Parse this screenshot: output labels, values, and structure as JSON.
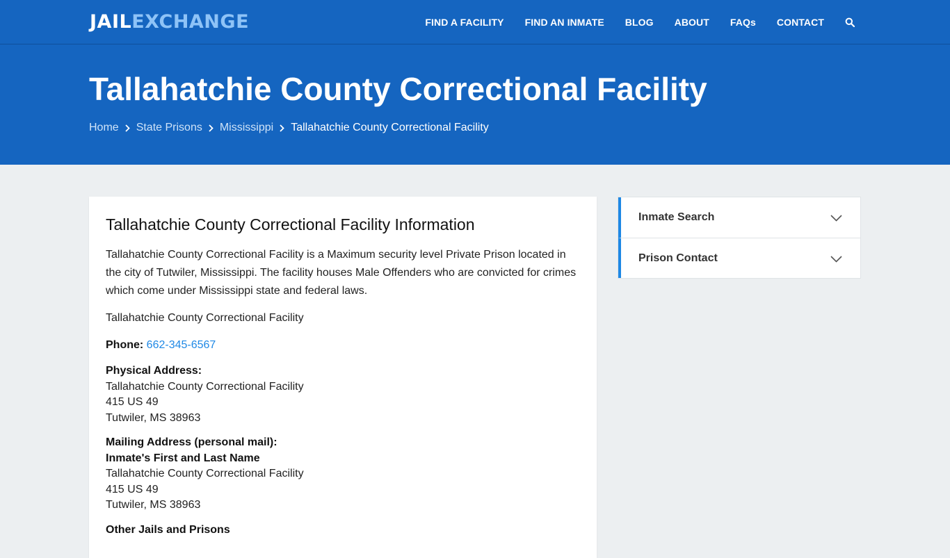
{
  "header": {
    "logo_part1": "JAIL",
    "logo_part2": "EXCHANGE",
    "nav": [
      "FIND A FACILITY",
      "FIND AN INMATE",
      "BLOG",
      "ABOUT",
      "FAQs",
      "CONTACT"
    ]
  },
  "hero": {
    "title": "Tallahatchie County Correctional Facility",
    "breadcrumb": [
      "Home",
      "State Prisons",
      "Mississippi",
      "Tallahatchie County Correctional Facility"
    ]
  },
  "main": {
    "heading": "Tallahatchie County Correctional Facility Information",
    "intro": "Tallahatchie County Correctional Facility is a Maximum security level Private Prison located in the city of Tutwiler, Mississippi. The facility houses Male Offenders who are convicted for crimes which come under Mississippi state and federal laws.",
    "facility_name": "Tallahatchie County Correctional Facility",
    "phone_label": "Phone:",
    "phone": "662-345-6567",
    "physical_label": "Physical Address:",
    "physical": [
      "Tallahatchie County Correctional Facility",
      "415 US 49",
      "Tutwiler, MS 38963"
    ],
    "mailing_label": "Mailing Address (personal mail):",
    "mailing_recipient": "Inmate's First and Last Name",
    "mailing": [
      "Tallahatchie County Correctional Facility",
      "415 US 49",
      "Tutwiler, MS 38963"
    ],
    "other_label": "Other Jails and Prisons"
  },
  "sidebar": {
    "items": [
      "Inmate Search",
      "Prison Contact"
    ]
  },
  "colors": {
    "brand": "#1565c0",
    "accent": "#1e88e5",
    "background": "#eceff1"
  }
}
